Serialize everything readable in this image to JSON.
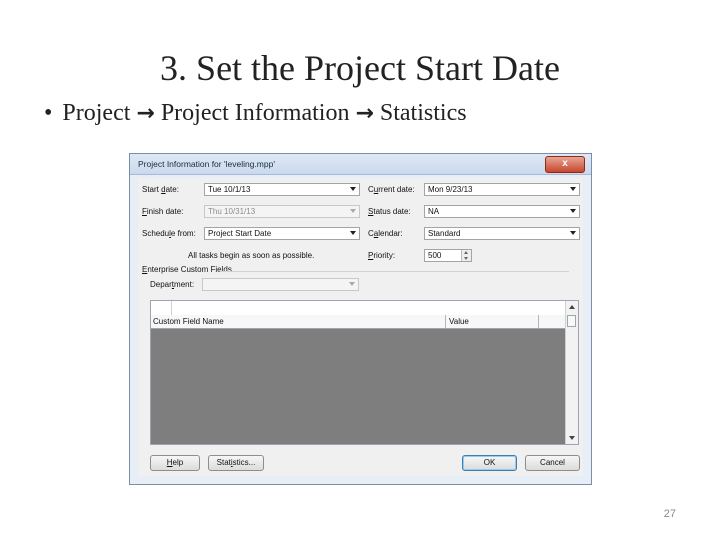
{
  "slide": {
    "title": "3. Set the Project Start Date",
    "bullet": {
      "marker": "•",
      "path": [
        "Project",
        "Project Information",
        "Statistics"
      ],
      "arrow": "→"
    },
    "page_number": "27"
  },
  "dialog": {
    "title": "Project Information for 'leveling.mpp'",
    "close_label": "x",
    "fields": {
      "start_date": {
        "label_pre": "Start ",
        "label_key": "d",
        "label_post": "ate:",
        "value": "Tue 10/1/13"
      },
      "finish_date": {
        "label_pre": "",
        "label_key": "F",
        "label_post": "inish date:",
        "value": "Thu 10/31/13"
      },
      "schedule_from": {
        "label_pre": "Schedu",
        "label_key": "l",
        "label_post": "e from:",
        "value": "Project Start Date"
      },
      "current_date": {
        "label_pre": "C",
        "label_key": "u",
        "label_post": "rrent date:",
        "value": "Mon 9/23/13"
      },
      "status_date": {
        "label_pre": "",
        "label_key": "S",
        "label_post": "tatus date:",
        "value": "NA"
      },
      "calendar": {
        "label_pre": "C",
        "label_key": "a",
        "label_post": "lendar:",
        "value": "Standard"
      },
      "priority": {
        "label_pre": "",
        "label_key": "P",
        "label_post": "riority:",
        "value": "500"
      }
    },
    "note": "All tasks begin as soon as possible.",
    "enterprise": {
      "group_pre": "",
      "group_key": "E",
      "group_post": "nterprise Custom Fields",
      "department": {
        "label_pre": "Depar",
        "label_key": "t",
        "label_post": "ment:",
        "value": ""
      }
    },
    "grid": {
      "columns": [
        "Custom Field Name",
        "Value"
      ]
    },
    "buttons": {
      "help": {
        "pre": "",
        "key": "H",
        "post": "elp"
      },
      "statistics": {
        "pre": "Stat",
        "key": "i",
        "post": "stics..."
      },
      "ok": "OK",
      "cancel": "Cancel"
    }
  }
}
